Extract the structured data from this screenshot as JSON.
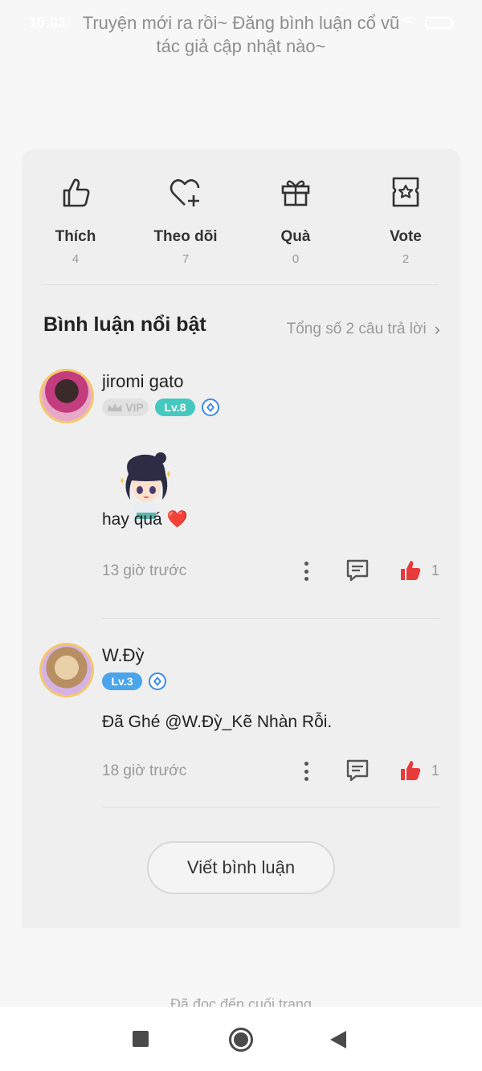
{
  "status_bar": {
    "time": "10:03",
    "icons": "wifi-icon battery-icon"
  },
  "author_note": "Truyện mới ra rồi~ Đăng bình luận cổ vũ tác giả cập nhật nào~",
  "actions": [
    {
      "label": "Thích",
      "count": "4",
      "icon": "thumbs-up-icon"
    },
    {
      "label": "Theo dõi",
      "count": "7",
      "icon": "heart-plus-icon"
    },
    {
      "label": "Quà",
      "count": "0",
      "icon": "gift-icon"
    },
    {
      "label": "Vote",
      "count": "2",
      "icon": "vote-ticket-icon"
    }
  ],
  "comments_section": {
    "title": "Bình luận nổi bật",
    "total_link": "Tổng số 2 câu trả lời",
    "comments": [
      {
        "username": "jiromi gato",
        "vip": "VIP",
        "level": "Lv.8",
        "text": "hay quá",
        "emoji": "❤️",
        "time": "13 giờ trước",
        "likes": "1"
      },
      {
        "username": "W.Đỳ",
        "level": "Lv.3",
        "text": "Đã Ghé @W.Đỳ_Kẽ Nhàn Rỗi.",
        "time": "18 giờ trước",
        "likes": "1"
      }
    ],
    "write_button": "Viết bình luận"
  },
  "end_text": "Đã đọc đến cuối trang",
  "colors": {
    "like_red": "#e83a3a",
    "level8_teal": "#45c8c0",
    "level3_blue": "#4aa5ec",
    "card_bg": "#efefef"
  }
}
